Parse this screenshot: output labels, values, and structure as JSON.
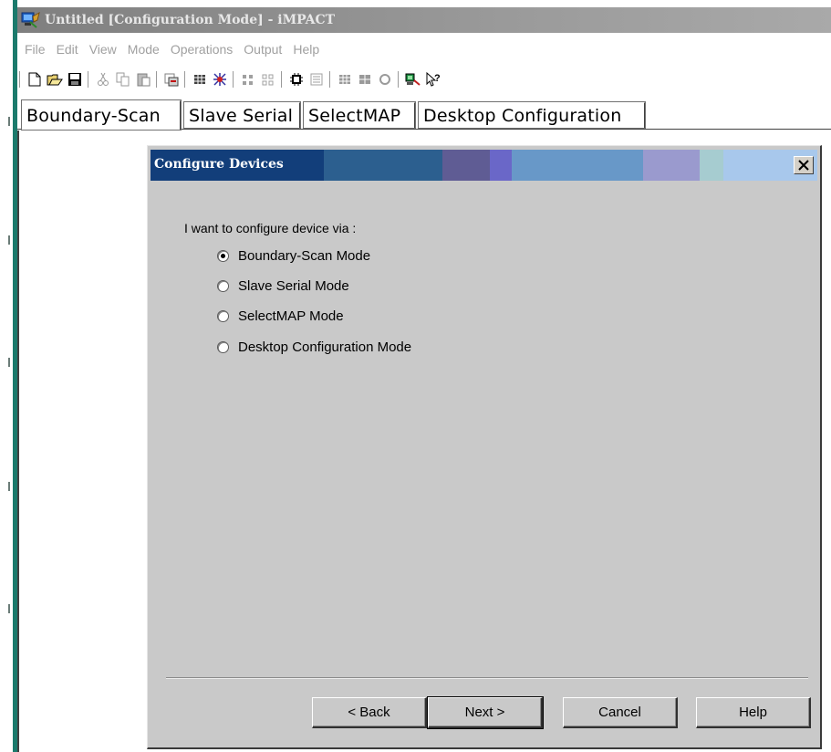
{
  "window": {
    "title": "Untitled [Configuration Mode] - iMPACT"
  },
  "menubar": {
    "items": [
      "File",
      "Edit",
      "View",
      "Mode",
      "Operations",
      "Output",
      "Help"
    ]
  },
  "toolbar": {
    "icons": [
      "new-file-icon",
      "open-folder-icon",
      "save-icon",
      "cut-icon",
      "copy-icon",
      "paste-icon",
      "program-icon",
      "chain-icon",
      "debug-icon",
      "grid-icon",
      "grid-alt-icon",
      "chip-icon",
      "list-icon",
      "connect-icon",
      "disconnect-icon",
      "refresh-icon",
      "cable-icon",
      "context-help-icon"
    ]
  },
  "tabs": [
    {
      "label": "Boundary-Scan",
      "active": true
    },
    {
      "label": "Slave Serial",
      "active": false
    },
    {
      "label": "SelectMAP",
      "active": false
    },
    {
      "label": "Desktop Configuration",
      "active": false
    }
  ],
  "dialog": {
    "title": "Configure Devices",
    "prompt": "I want to configure device via :",
    "options": [
      {
        "label": "Boundary-Scan Mode",
        "selected": true
      },
      {
        "label": "Slave Serial Mode",
        "selected": false
      },
      {
        "label": "SelectMAP Mode",
        "selected": false
      },
      {
        "label": "Desktop Configuration Mode",
        "selected": false
      }
    ],
    "buttons": {
      "back": "< Back",
      "next": "Next >",
      "cancel": "Cancel",
      "help": "Help"
    }
  },
  "colors": {
    "title_gradient": [
      "#123e7a",
      "#2c5f8f",
      "#6a7bb0",
      "#6a8fc8",
      "#9fc2e8"
    ],
    "dialog_bg": "#c9c9c9",
    "app_accent": "#1b7a6c"
  }
}
